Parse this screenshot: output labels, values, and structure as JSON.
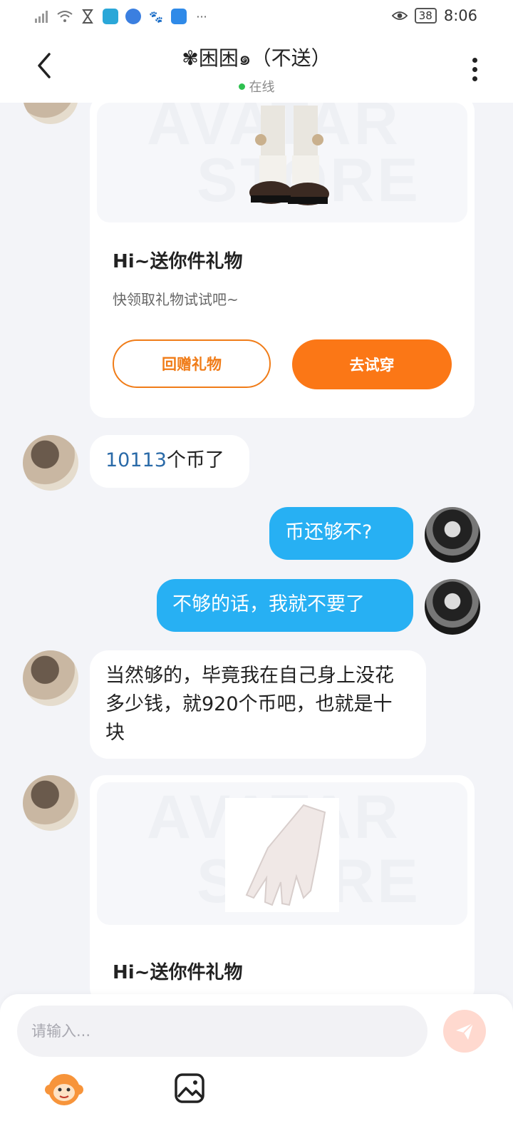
{
  "status_bar": {
    "time": "8:06",
    "battery": "38",
    "icons": [
      "signal-icon",
      "wifi-icon",
      "hourglass-icon",
      "app-icon",
      "browser-icon",
      "baidu-icon",
      "cloud-icon",
      "more-dots-icon",
      "eye-icon"
    ],
    "more_dots": "···"
  },
  "header": {
    "back_icon": "‹",
    "title": "✾困困๑（不送）",
    "status": "在线"
  },
  "messages": {
    "card1": {
      "title": "Hi~送你件礼物",
      "subtitle": "快领取礼物试试吧~",
      "btn_return": "回赠礼物",
      "btn_try": "去试穿"
    },
    "msg1_num": "10113",
    "msg1_rest": "个币了",
    "msg2": "币还够不?",
    "msg3": "不够的话，我就不要了",
    "msg4": "当然够的，毕竟我在自己身上没花多少钱，就920个币吧，也就是十块",
    "card2": {
      "title": "Hi~送你件礼物"
    }
  },
  "composer": {
    "placeholder": "请输入..."
  },
  "colors": {
    "accent_orange": "#fb7716",
    "bubble_blue": "#27b0f3",
    "online_green": "#2ec04f"
  }
}
